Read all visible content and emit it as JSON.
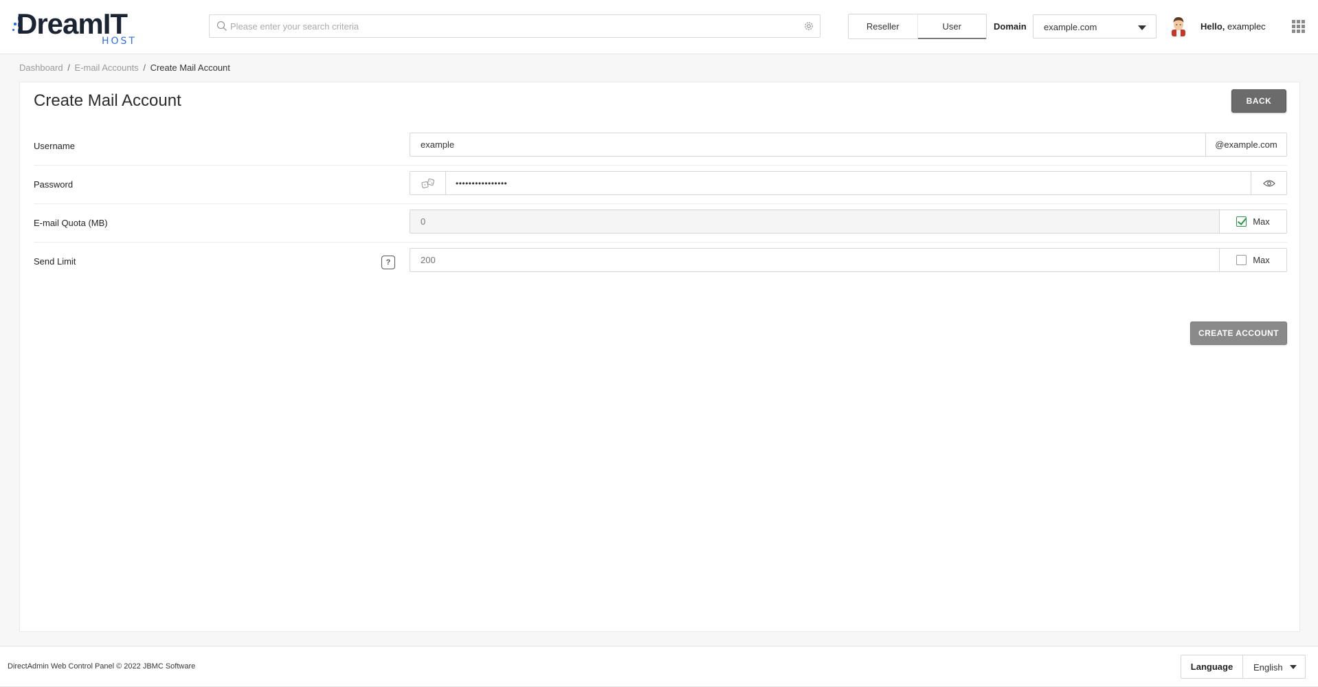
{
  "header": {
    "logo": {
      "main": "DreamIT",
      "sub": "HOST"
    },
    "search": {
      "placeholder": "Please enter your search criteria",
      "value": ""
    },
    "roles": [
      "Reseller",
      "User"
    ],
    "active_role": "User",
    "domain_label": "Domain",
    "domain_value": "example.com",
    "greeting": "Hello,",
    "username": "examplec"
  },
  "breadcrumb": {
    "items": [
      "Dashboard",
      "E-mail Accounts"
    ],
    "separator": "/",
    "current": "Create Mail Account"
  },
  "page": {
    "title": "Create Mail Account",
    "back_label": "BACK"
  },
  "form": {
    "username": {
      "label": "Username",
      "value": "example",
      "suffix": "@example.com"
    },
    "password": {
      "label": "Password",
      "value": "••••••••••••••••"
    },
    "quota": {
      "label": "E-mail Quota (MB)",
      "placeholder": "0",
      "max_label": "Max",
      "max_checked": true
    },
    "send_limit": {
      "label": "Send Limit",
      "help": "?",
      "placeholder": "200",
      "max_label": "Max",
      "max_checked": false
    },
    "submit_label": "CREATE ACCOUNT"
  },
  "footer": {
    "copyright": "DirectAdmin Web Control Panel © 2022 JBMC Software",
    "language_label": "Language",
    "language_value": "English"
  },
  "colors": {
    "brand_dark": "#1b2433",
    "brand_blue": "#2f6fe8",
    "check_green": "#2b9348",
    "button_dark": "#6b6b6b",
    "button_gray": "#8a8a8a"
  }
}
